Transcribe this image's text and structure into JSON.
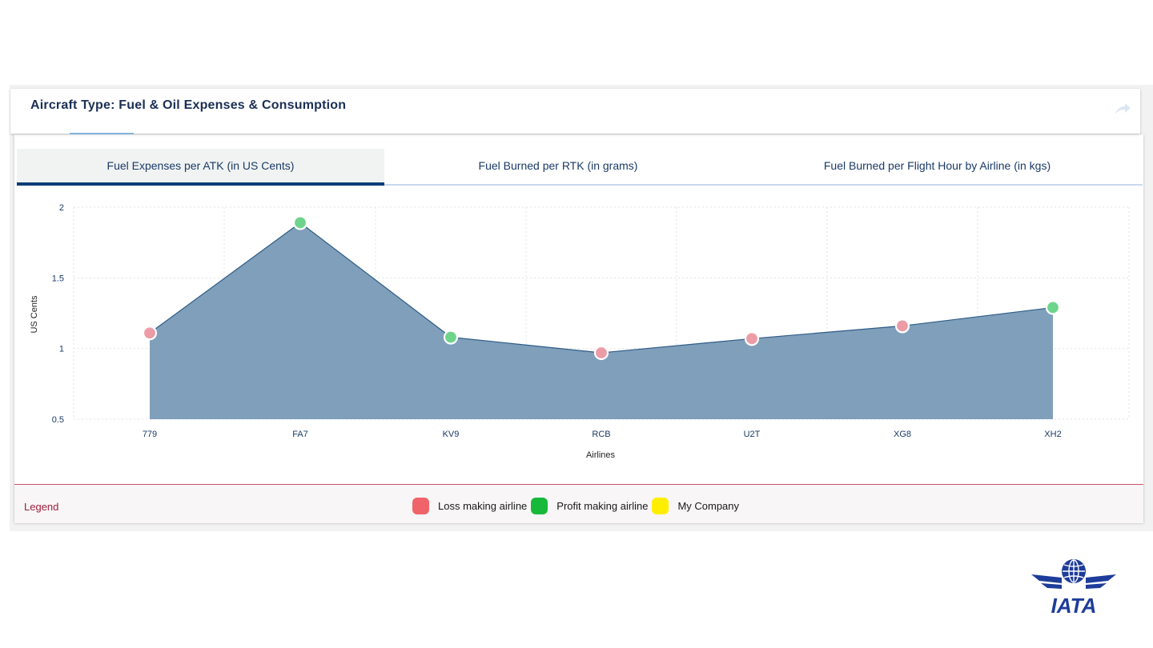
{
  "header": {
    "title": "Aircraft Type: Fuel & Oil Expenses & Consumption",
    "share_icon": "share-arrow-icon"
  },
  "tabs": [
    {
      "label": "Fuel Expenses per ATK (in US Cents)",
      "active": true
    },
    {
      "label": "Fuel Burned per RTK (in grams)",
      "active": false
    },
    {
      "label": "Fuel Burned per Flight Hour by Airline (in kgs)",
      "active": false
    }
  ],
  "chart_data": {
    "type": "area",
    "xlabel": "Airlines",
    "ylabel": "US Cents",
    "categories": [
      "779",
      "FA7",
      "KV9",
      "RCB",
      "U2T",
      "XG8",
      "XH2"
    ],
    "values": [
      1.11,
      1.89,
      1.08,
      0.97,
      1.07,
      1.16,
      1.29
    ],
    "status": [
      "loss",
      "profit",
      "profit",
      "loss",
      "loss",
      "loss",
      "profit"
    ],
    "ylim": [
      0.5,
      2
    ],
    "yticks": [
      "0.5",
      "1",
      "1.5",
      "2"
    ],
    "grid": true,
    "colors": {
      "area": "#7f9fbb",
      "line": "#2f5c86",
      "loss": "#f06070",
      "profit": "#17b93a"
    }
  },
  "legend": {
    "title": "Legend",
    "items": [
      {
        "label": "Loss making airline",
        "color": "#f06469"
      },
      {
        "label": "Profit making airline",
        "color": "#17b93a"
      },
      {
        "label": "My Company",
        "color": "#ffee00"
      }
    ]
  },
  "logo": {
    "text": "IATA",
    "color": "#1e3c9a"
  }
}
